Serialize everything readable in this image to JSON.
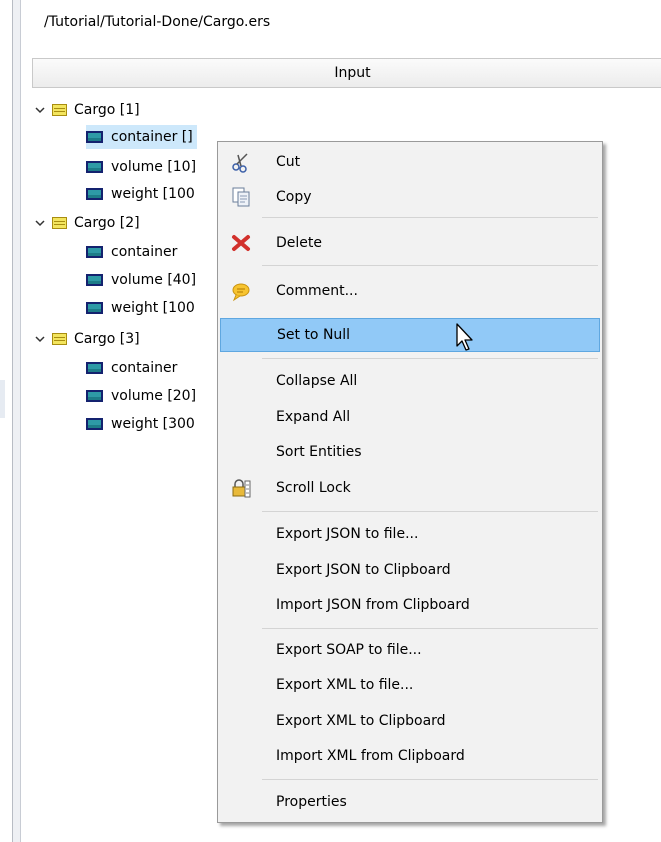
{
  "path": "/Tutorial/Tutorial-Done/Cargo.ers",
  "column_header": "Input",
  "tree": {
    "cargo1": {
      "label": "Cargo [1]",
      "container": "container []",
      "volume": "volume [10]",
      "weight": "weight [100"
    },
    "cargo2": {
      "label": "Cargo [2]",
      "container": "container",
      "volume": "volume [40]",
      "weight": "weight [100"
    },
    "cargo3": {
      "label": "Cargo [3]",
      "container": "container",
      "volume": "volume [20]",
      "weight": "weight [300"
    }
  },
  "menu": {
    "cut": "Cut",
    "copy": "Copy",
    "delete": "Delete",
    "comment": "Comment...",
    "set_null": "Set to Null",
    "collapse_all": "Collapse All",
    "expand_all": "Expand All",
    "sort_entities": "Sort Entities",
    "scroll_lock": "Scroll Lock",
    "export_json_file": "Export JSON to file...",
    "export_json_clip": "Export JSON to Clipboard",
    "import_json_clip": "Import JSON from Clipboard",
    "export_soap_file": "Export SOAP to file...",
    "export_xml_file": "Export XML to file...",
    "export_xml_clip": "Export XML to Clipboard",
    "import_xml_clip": "Import XML from Clipboard",
    "properties": "Properties"
  },
  "colors": {
    "highlight": "#91c9f7",
    "selection": "#cde8fb",
    "entity_icon": "#f3e55e",
    "attr_icon": "#2e9aa6"
  }
}
